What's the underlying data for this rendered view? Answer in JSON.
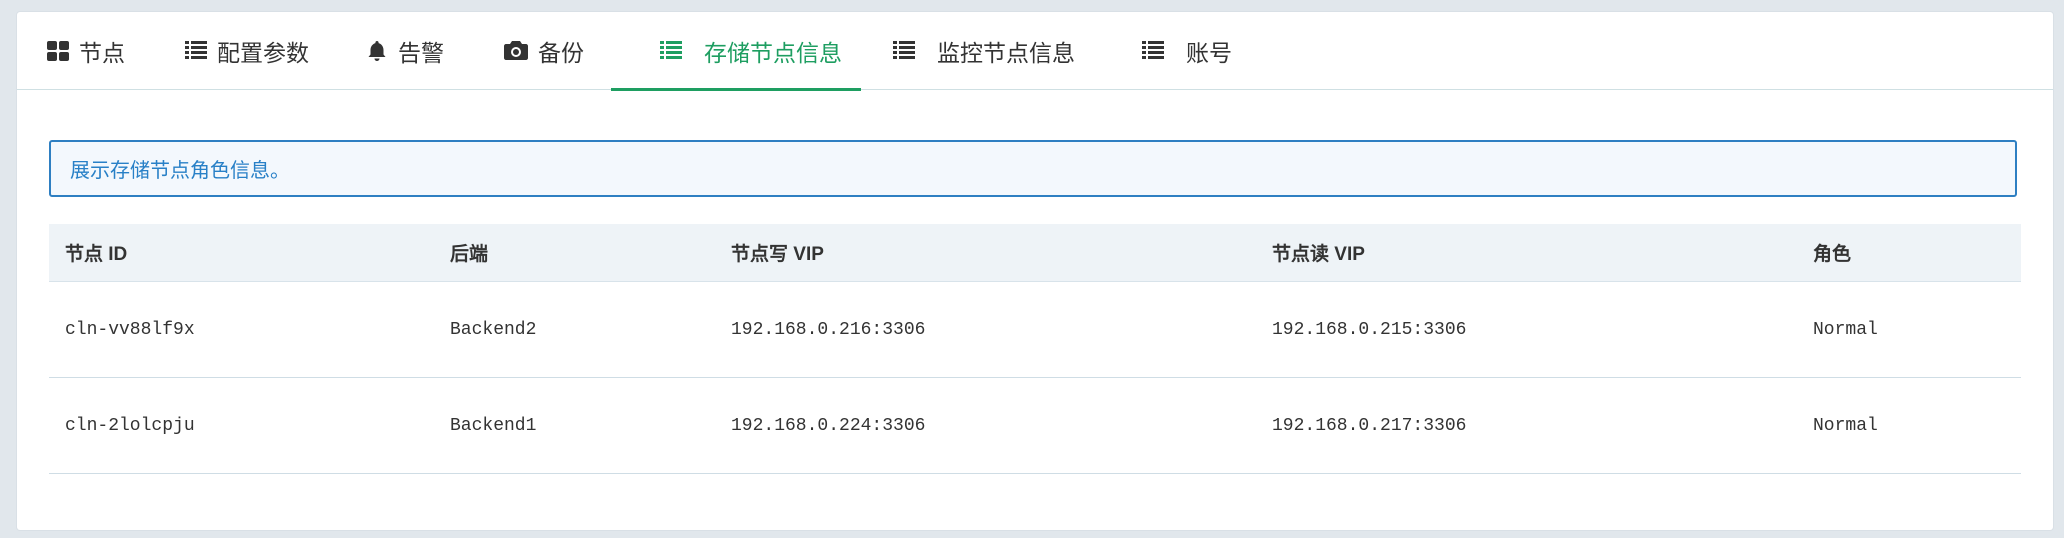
{
  "tabs": [
    {
      "label": "节点",
      "icon": "grid-icon"
    },
    {
      "label": "配置参数",
      "icon": "list-icon"
    },
    {
      "label": "告警",
      "icon": "bell-icon"
    },
    {
      "label": "备份",
      "icon": "camera-icon"
    },
    {
      "label": "存储节点信息",
      "icon": "list-icon",
      "active": true
    },
    {
      "label": "监控节点信息",
      "icon": "list-icon"
    },
    {
      "label": "账号",
      "icon": "list-icon"
    }
  ],
  "colors": {
    "active": "#1e9e61",
    "info_border": "#2e7fc2",
    "info_text": "#2880c7"
  },
  "info_text": "展示存储节点角色信息。",
  "table": {
    "headers": [
      "节点 ID",
      "后端",
      "节点写 VIP",
      "节点读 VIP",
      "角色"
    ],
    "rows": [
      [
        "cln-vv88lf9x",
        "Backend2",
        "192.168.0.216:3306",
        "192.168.0.215:3306",
        "Normal"
      ],
      [
        "cln-2lolcpju",
        "Backend1",
        "192.168.0.224:3306",
        "192.168.0.217:3306",
        "Normal"
      ]
    ]
  }
}
